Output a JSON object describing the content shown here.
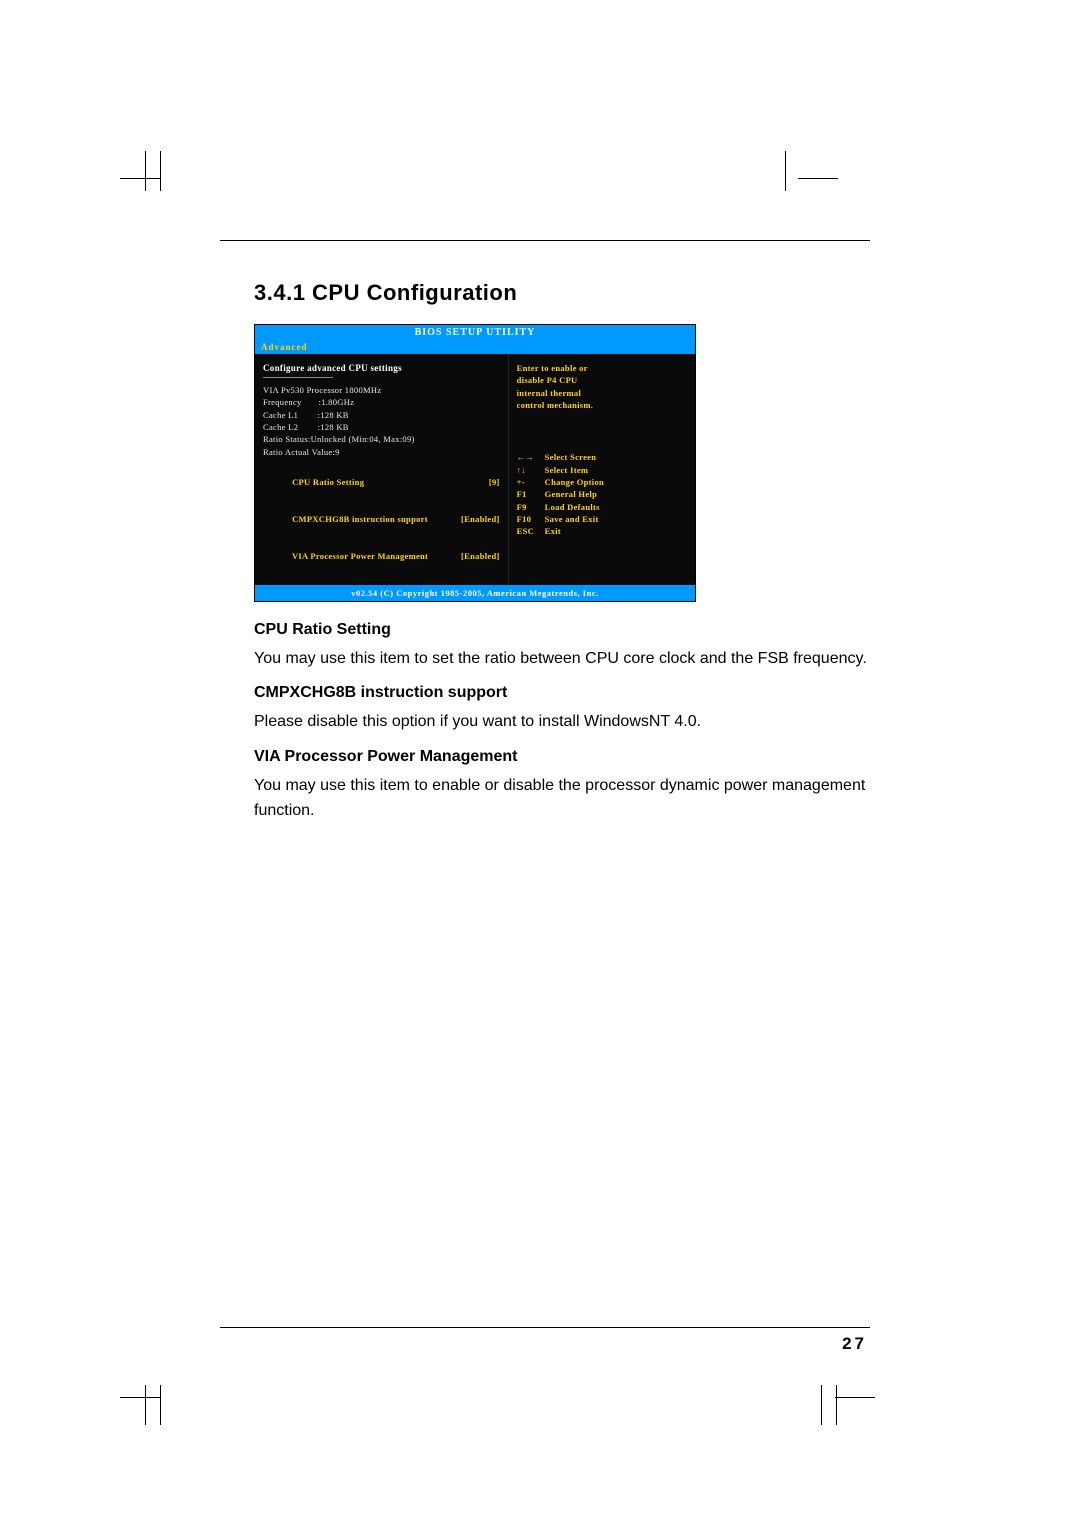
{
  "section_title": "3.4.1 CPU Configuration",
  "bios": {
    "title": "BIOS SETUP UTILITY",
    "active_tab": "Advanced",
    "panel_header": "Configure advanced CPU settings",
    "info_lines": [
      "VIA Pv530 Processor 1800MHz",
      "Frequency       :1.80GHz",
      "Cache L1        :128 KB",
      "Cache L2        :128 KB",
      "Ratio Status:Unlocked (Min:04, Max:09)",
      "Ratio Actual Value:9"
    ],
    "options": [
      {
        "label": "CPU Ratio Setting",
        "value": "[9]",
        "selected": true
      },
      {
        "label": "CMPXCHG8B instruction support",
        "value": "[Enabled]",
        "selected": false
      },
      {
        "label": "VIA Processor Power Management",
        "value": "[Enabled]",
        "selected": false
      }
    ],
    "help_text": [
      "Enter to enable or",
      "disable P4 CPU",
      "internal thermal",
      "control mechanism."
    ],
    "nav": [
      {
        "key": "←→",
        "action": "Select Screen"
      },
      {
        "key": "↑↓",
        "action": "Select Item"
      },
      {
        "key": "+-",
        "action": "Change Option"
      },
      {
        "key": "F1",
        "action": "General Help"
      },
      {
        "key": "F9",
        "action": "Load Defaults"
      },
      {
        "key": "F10",
        "action": "Save and Exit"
      },
      {
        "key": "ESC",
        "action": "Exit"
      }
    ],
    "footer": "v02.54 (C) Copyright 1985-2005, American Megatrends, Inc."
  },
  "descriptions": [
    {
      "heading": "CPU Ratio Setting",
      "body": "You may use this item to set the ratio between CPU core clock and the FSB frequency."
    },
    {
      "heading": "CMPXCHG8B instruction support",
      "body": "Please disable this option if you want to install WindowsNT 4.0."
    },
    {
      "heading": "VIA Processor Power Management",
      "body": "You may use this item to enable or disable the processor dynamic power management function."
    }
  ],
  "page_number": "27"
}
